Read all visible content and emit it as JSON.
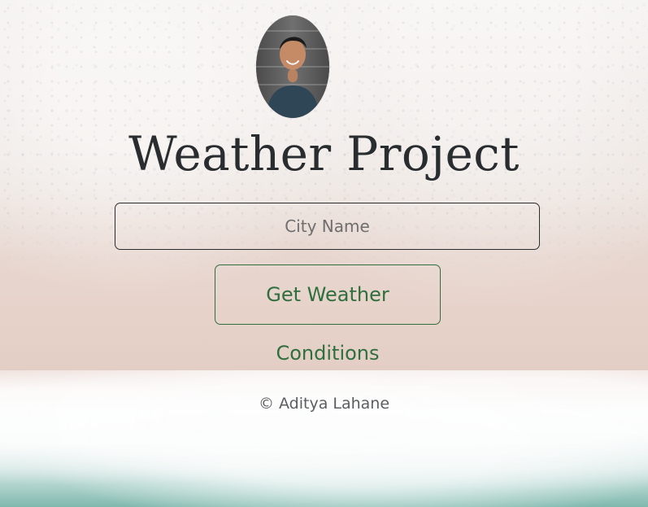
{
  "page": {
    "title": "Weather Project"
  },
  "profile": {
    "avatar_icon": "avatar"
  },
  "search": {
    "placeholder": "City Name",
    "button_label": "Get Weather Conditions"
  },
  "footer": {
    "text": "© Aditya Lahane"
  },
  "colors": {
    "title_text": "#2a2d2f",
    "input_border": "#2a2d2f",
    "button_green": "#2f6f3d",
    "footer_text": "#5b5e61"
  }
}
